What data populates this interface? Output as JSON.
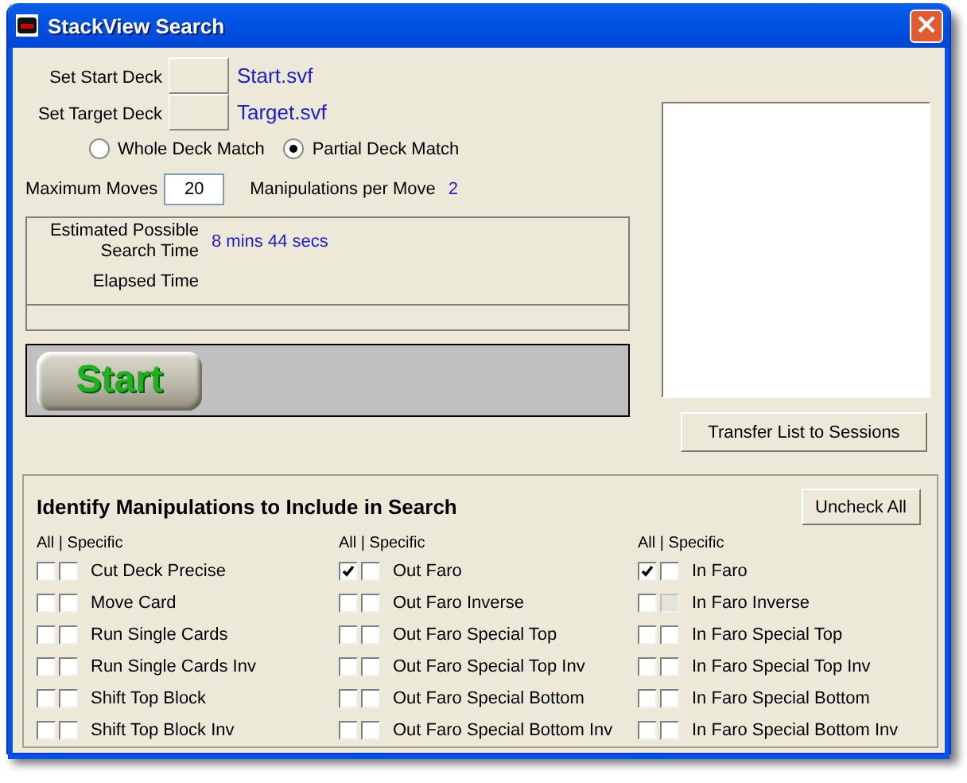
{
  "window": {
    "title": "StackView Search",
    "close": "×"
  },
  "start_deck": {
    "label": "Set Start Deck",
    "file": "Start.svf"
  },
  "target_deck": {
    "label": "Set Target Deck",
    "file": "Target.svf"
  },
  "match_options": [
    {
      "label": "Whole Deck Match",
      "selected": false
    },
    {
      "label": "Partial Deck Match",
      "selected": true
    }
  ],
  "max_moves": {
    "label": "Maximum Moves",
    "value": "20"
  },
  "manipulations_per_move": {
    "label": "Manipulations per Move",
    "value": "2"
  },
  "estimate": {
    "label": "Estimated Possible Search Time",
    "value": "8 mins 44 secs"
  },
  "elapsed": {
    "label": "Elapsed Time"
  },
  "start_button": "Start",
  "transfer_button": "Transfer List to Sessions",
  "manipulations": {
    "title": "Identify Manipulations to Include in Search",
    "uncheck_button": "Uncheck All",
    "columns": [
      {
        "header": "All | Specific",
        "items": [
          {
            "label": "Cut Deck Precise",
            "all_checked": false,
            "specific_checked": false,
            "specific_disabled": false
          },
          {
            "label": "Move Card",
            "all_checked": false,
            "specific_checked": false,
            "specific_disabled": false
          },
          {
            "label": "Run Single Cards",
            "all_checked": false,
            "specific_checked": false,
            "specific_disabled": false
          },
          {
            "label": "Run Single Cards Inv",
            "all_checked": false,
            "specific_checked": false,
            "specific_disabled": false
          },
          {
            "label": "Shift Top Block",
            "all_checked": false,
            "specific_checked": false,
            "specific_disabled": false
          },
          {
            "label": "Shift Top Block Inv",
            "all_checked": false,
            "specific_checked": false,
            "specific_disabled": false
          }
        ]
      },
      {
        "header": "All | Specific",
        "items": [
          {
            "label": "Out Faro",
            "all_checked": true,
            "specific_checked": false,
            "specific_disabled": false
          },
          {
            "label": "Out Faro Inverse",
            "all_checked": false,
            "specific_checked": false,
            "specific_disabled": false
          },
          {
            "label": "Out Faro Special Top",
            "all_checked": false,
            "specific_checked": false,
            "specific_disabled": false
          },
          {
            "label": "Out Faro Special Top Inv",
            "all_checked": false,
            "specific_checked": false,
            "specific_disabled": false
          },
          {
            "label": "Out Faro Special Bottom",
            "all_checked": false,
            "specific_checked": false,
            "specific_disabled": false
          },
          {
            "label": "Out Faro Special Bottom Inv",
            "all_checked": false,
            "specific_checked": false,
            "specific_disabled": false
          }
        ]
      },
      {
        "header": "All | Specific",
        "items": [
          {
            "label": "In Faro",
            "all_checked": true,
            "specific_checked": false,
            "specific_disabled": false
          },
          {
            "label": "In Faro Inverse",
            "all_checked": false,
            "specific_checked": false,
            "specific_disabled": true
          },
          {
            "label": "In Faro Special Top",
            "all_checked": false,
            "specific_checked": false,
            "specific_disabled": false
          },
          {
            "label": "In Faro Special Top Inv",
            "all_checked": false,
            "specific_checked": false,
            "specific_disabled": false
          },
          {
            "label": "In Faro Special Bottom",
            "all_checked": false,
            "specific_checked": false,
            "specific_disabled": false
          },
          {
            "label": "In Faro Special Bottom Inv",
            "all_checked": false,
            "specific_checked": false,
            "specific_disabled": false
          }
        ]
      }
    ]
  }
}
